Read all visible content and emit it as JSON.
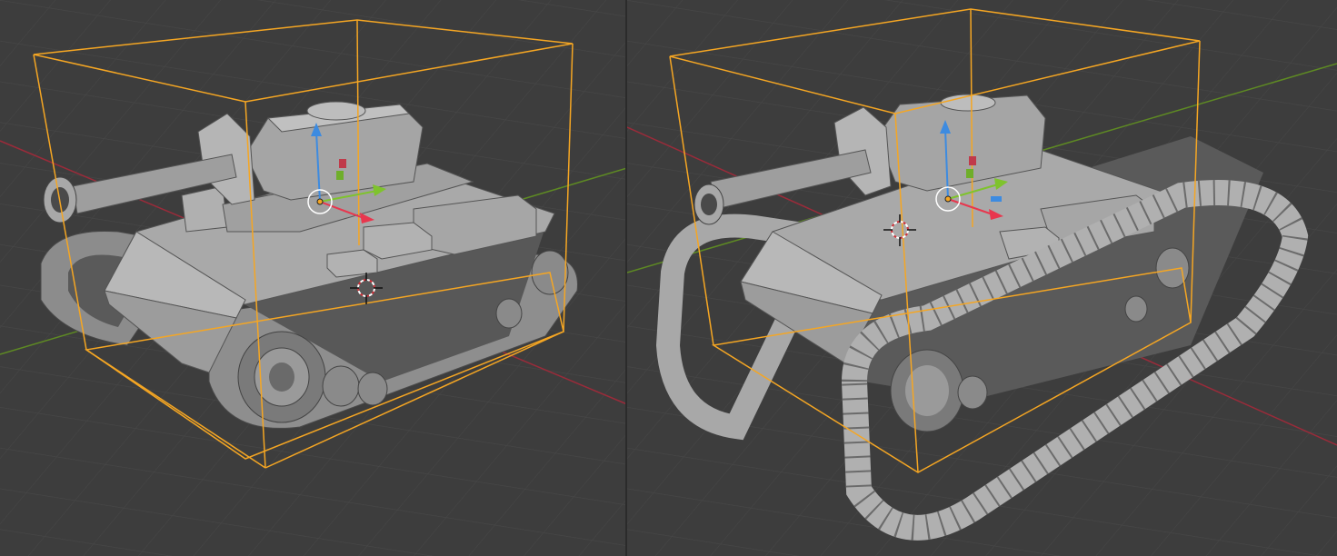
{
  "app": {
    "name": ""
  },
  "viewports": [
    {
      "id": "left",
      "object": {
        "kind": "tank",
        "tracks": "normal",
        "selected": true
      },
      "gizmo": {
        "axes": [
          "x",
          "y",
          "z"
        ]
      }
    },
    {
      "id": "right",
      "object": {
        "kind": "tank",
        "tracks": "oversized-loops",
        "selected": true
      },
      "gizmo": {
        "axes": [
          "x",
          "y",
          "z"
        ]
      }
    }
  ],
  "colors": {
    "background": "#3d3d3d",
    "grid_line": "#474747",
    "x_axis": "#9a2b3a",
    "y_axis": "#5e8a23",
    "selection_box": "#f5a623",
    "gizmo_x": "#e8374e",
    "gizmo_y": "#7fc32d",
    "gizmo_z": "#3d8be0",
    "mesh_light": "#b8b8b8",
    "mesh_mid": "#9a9a9a",
    "mesh_dark": "#6e6e6e"
  }
}
